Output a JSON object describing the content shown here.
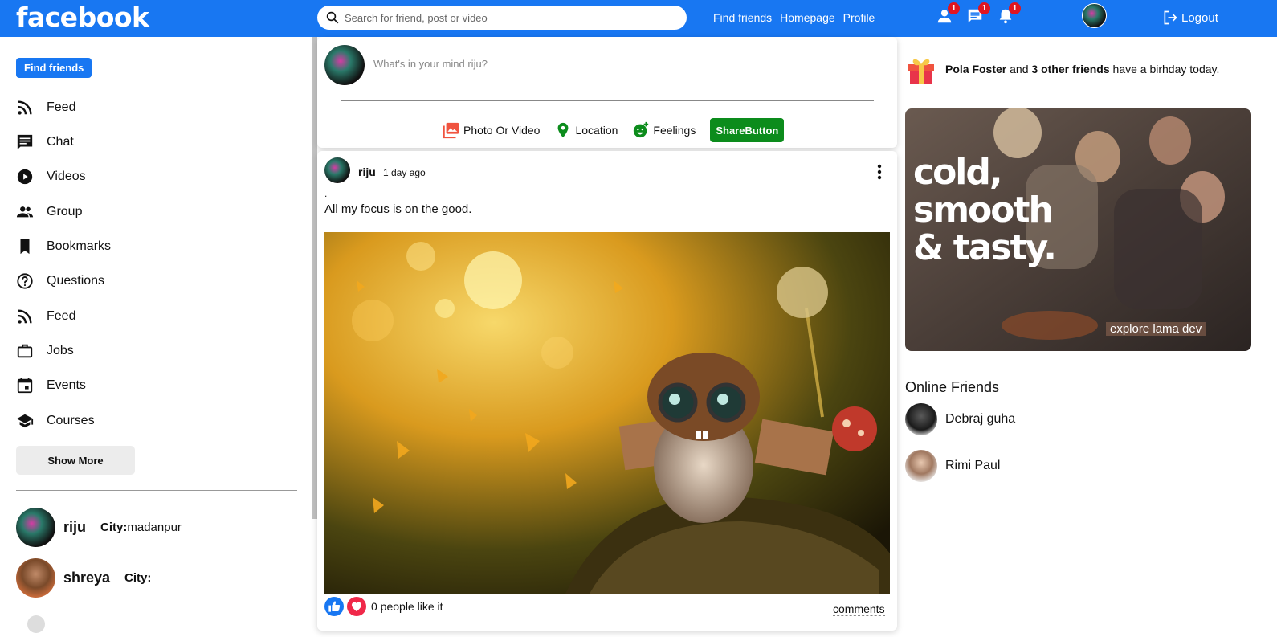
{
  "topbar": {
    "logo": "facebook",
    "search_placeholder": "Search for friend, post or video",
    "links": [
      "Find friends",
      "Homepage",
      "Profile"
    ],
    "badges": {
      "friends": "1",
      "messages": "1",
      "notifications": "1"
    },
    "logout": "Logout",
    "brand_color": "#1877f2"
  },
  "sidebar": {
    "find_friends": "Find friends",
    "items": [
      {
        "label": "Feed",
        "icon": "rss-icon"
      },
      {
        "label": "Chat",
        "icon": "chat-icon"
      },
      {
        "label": "Videos",
        "icon": "play-circle-icon"
      },
      {
        "label": "Group",
        "icon": "group-icon"
      },
      {
        "label": "Bookmarks",
        "icon": "bookmark-icon"
      },
      {
        "label": "Questions",
        "icon": "help-circle-icon"
      },
      {
        "label": "Feed",
        "icon": "rss-icon"
      },
      {
        "label": "Jobs",
        "icon": "briefcase-icon"
      },
      {
        "label": "Events",
        "icon": "calendar-icon"
      },
      {
        "label": "Courses",
        "icon": "school-icon"
      }
    ],
    "show_more": "Show More",
    "friends": [
      {
        "name": "riju",
        "city_label": "City:",
        "city": "madanpur"
      },
      {
        "name": "shreya",
        "city_label": "City:",
        "city": ""
      }
    ]
  },
  "share": {
    "placeholder": "What's in your mind riju?",
    "options": [
      "Photo Or Video",
      "Location",
      "Feelings"
    ],
    "button": "ShareButton"
  },
  "post": {
    "author": "riju",
    "time": "1 day ago",
    "dot": ".",
    "text": "All my focus is on the good.",
    "likes": "0 people like it",
    "comments": "comments"
  },
  "right": {
    "birthday": {
      "name": "Pola Foster",
      "mid": "and",
      "others": "3 other friends",
      "suffix": "have a birhday today."
    },
    "ad": {
      "headline": [
        "cold,",
        "smooth",
        "& tasty."
      ],
      "tagline": "explore lama dev"
    },
    "online_title": "Online Friends",
    "online": [
      "Debraj guha",
      "Rimi Paul"
    ]
  }
}
